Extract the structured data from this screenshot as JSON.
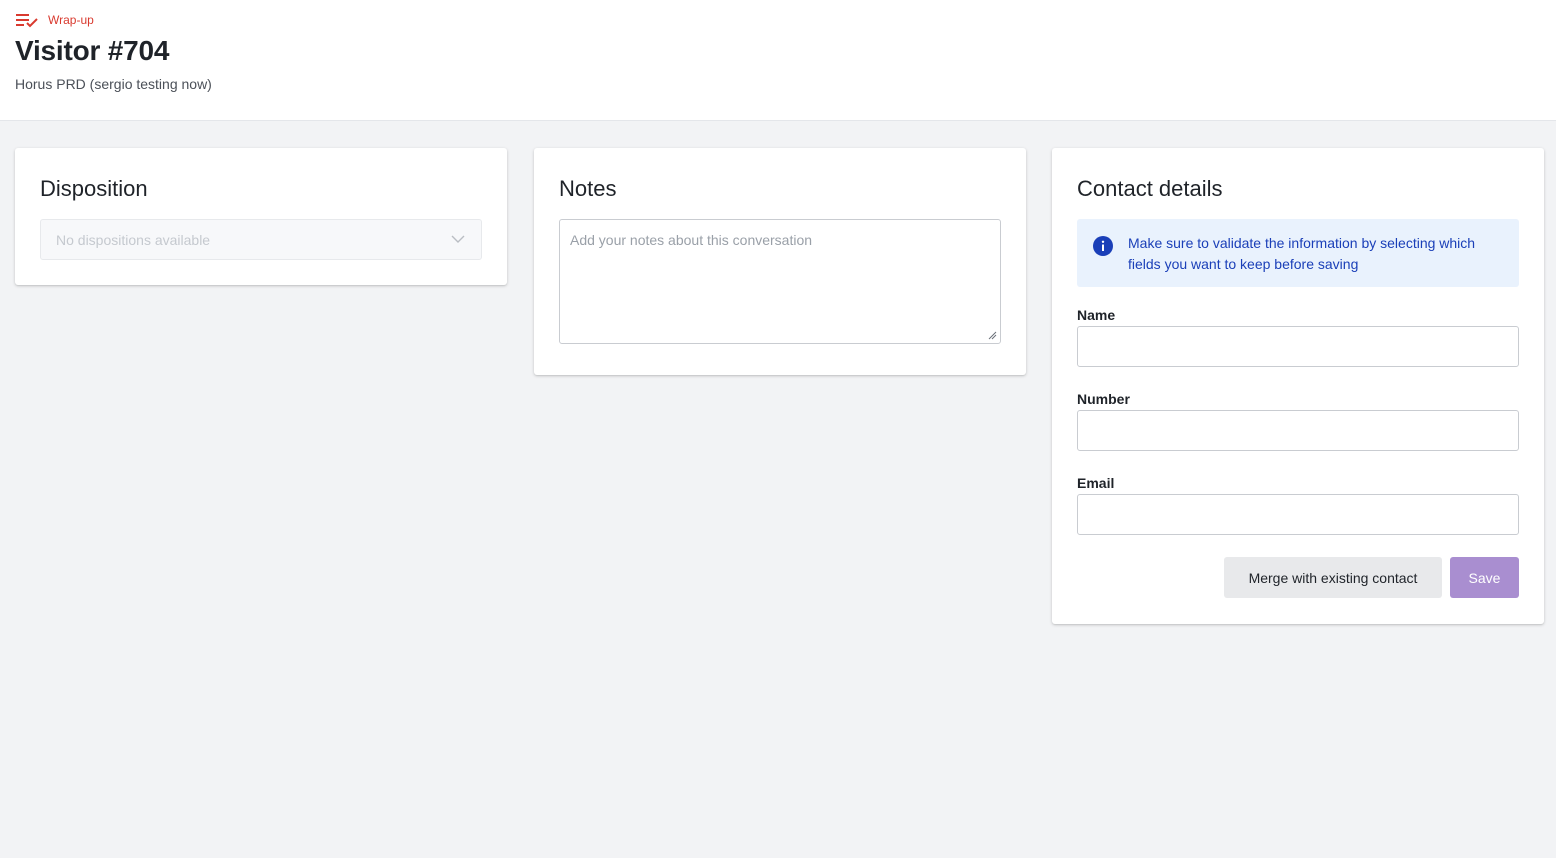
{
  "header": {
    "breadcrumb": {
      "label": "Wrap-up",
      "icon": "wrap-up-icon"
    },
    "title": "Visitor #704",
    "subtitle": "Horus PRD (sergio testing now)"
  },
  "disposition": {
    "title": "Disposition",
    "select_value": "No dispositions available"
  },
  "notes": {
    "title": "Notes",
    "placeholder": "Add your notes about this conversation"
  },
  "contact": {
    "title": "Contact details",
    "info_text": "Make sure to validate the information by selecting which fields you want to keep before saving",
    "fields": [
      {
        "label": "Name",
        "value": ""
      },
      {
        "label": "Number",
        "value": ""
      },
      {
        "label": "Email",
        "value": ""
      }
    ],
    "merge_label": "Merge with existing contact",
    "save_label": "Save"
  },
  "colors": {
    "accent_red": "#d93a2f",
    "info_blue": "#1a3fb8",
    "info_bg": "#e9f2fd",
    "save_purple": "#a98ed0",
    "page_bg": "#f2f3f5"
  }
}
